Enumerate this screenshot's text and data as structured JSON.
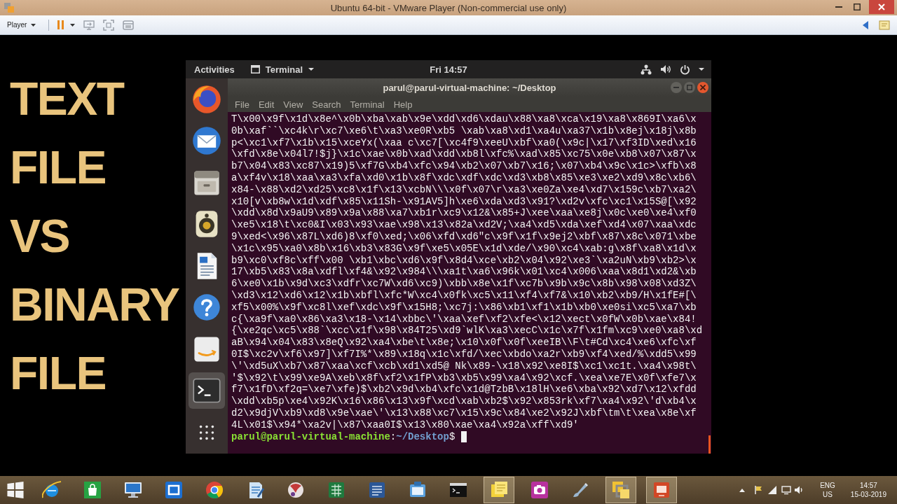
{
  "host_window": {
    "title": "Ubuntu 64-bit - VMware Player (Non-commercial use only)",
    "toolbar": {
      "player_menu": "Player"
    }
  },
  "overlay_title": "TEXT FILE VS BINARY FILE",
  "guest": {
    "top_bar": {
      "activities": "Activities",
      "app_menu": "Terminal",
      "clock": "Fri 14:57"
    },
    "dock": [
      {
        "kind": "browser",
        "selected": false
      },
      {
        "kind": "mail",
        "selected": false
      },
      {
        "kind": "files",
        "selected": false
      },
      {
        "kind": "music",
        "selected": false
      },
      {
        "kind": "writer",
        "selected": false
      },
      {
        "kind": "help",
        "selected": false
      },
      {
        "kind": "store",
        "selected": false
      },
      {
        "kind": "terminal",
        "selected": true
      },
      {
        "kind": "apps",
        "selected": false
      }
    ],
    "terminal": {
      "title": "parul@parul-virtual-machine: ~/Desktop",
      "menu": [
        "File",
        "Edit",
        "View",
        "Search",
        "Terminal",
        "Help"
      ],
      "output_lines": [
        "T\\x00\\x9f\\x1d\\x8e^\\x0b\\xba\\xab\\x9e\\xdd\\xd6\\xdau\\x88\\xa8\\xca\\x19\\xa8\\x869I\\xa6\\x",
        "0b\\xaf``\\xc4k\\r\\xc7\\xe6\\t\\xa3\\xe0R\\xb5 \\xab\\xa8\\xd1\\xa4u\\xa37\\x1b\\x8ej\\x18j\\x8b",
        "p<\\xc1\\xf7\\x1b\\x15\\xceYx(\\xaa c\\xc7[\\xc4f9\\xeeU\\xbf\\xa0(\\x9c|\\x17\\xf3ID\\xed\\x16",
        "\\xfd\\x8e\\x04l7!$j}\\x1c\\xae\\x0b\\xad\\xdd\\xb8l\\xfc%\\xad\\x85\\xc75\\x0e\\xb8\\x07\\x87\\x",
        "b7\\x04\\x83\\xc87\\x19)5\\xf7G\\xb4\\xfc\\x94\\xb2\\x07\\xb7\\x16;\\x07\\xb4\\x9c\\x1c>\\xfb\\x8",
        "a\\xf4v\\x18\\xaa\\xa3\\xfa\\xd0\\x1b\\x8f\\xdc\\xdf\\xdc\\xd3\\xb8\\x85\\xe3\\xe2\\xd9\\x8c\\xb6\\",
        "x84-\\x88\\xd2\\xd25\\xc8\\x1f\\x13\\xcbN\\\\\\x0f\\x07\\r\\xa3\\xe0Za\\xe4\\xd7\\x159c\\xb7\\xa2\\",
        "x10[v\\xb8w\\x1d\\xdf\\x85\\x11Sh-\\x91AV5]h\\xe6\\xda\\xd3\\x91?\\xd2v\\xfc\\xc1\\x15S@[\\x92",
        "\\xdd\\x8d\\x9aU9\\x89\\x9a\\x88\\xa7\\xb1r\\xc9\\x12&\\x85+J\\xee\\xaa\\xe8j\\x0c\\xe0\\xe4\\xf0",
        "\\xe5\\x18\\t\\xc0&I\\x03\\x93\\xae\\x98\\x13\\x82a\\xd2V;\\xa4\\xd5\\xda\\xef\\xd4\\x07\\xaa\\xdc",
        "9\\xed<\\x96\\x87L\\xd6)8\\xf0\\xed;\\x06\\xfd\\xd6\"c\\x9f\\x1f\\x9ej2\\xbf\\x87\\x8c\\x071\\xbe",
        "\\x1c\\x95\\xa0\\x8b\\x16\\xb3\\x83G\\x9f\\xe5\\x05E\\x1d\\xde/\\x90\\xc4\\xab:g\\x8f\\xa8\\x1d\\x",
        "b9\\xc0\\xf8c\\xff\\x00 \\xb1\\xbc\\xd6\\x9f\\x8d4\\xce\\xb2\\x04\\x92\\xe3`\\xa2uN\\xb9\\xb2>\\x",
        "17\\xb5\\x83\\x8a\\xdfl\\xf4&\\x92\\x984\\\\\\xa1t\\xa6\\x96k\\x01\\xc4\\x006\\xaa\\x8d1\\xd2&\\xb",
        "6\\xe0\\x1b\\x9d\\xc3\\xdfr\\xc7W\\xd6\\xc9)\\xbb\\x8e\\x1f\\xc7b\\x9b\\x9c\\x8b\\x98\\x08\\xd3Z\\",
        "\\xd3\\x12\\xd6\\x12\\x1b\\xbfl\\xfc*W\\xc4\\x0fk\\xc5\\x11\\xf4\\xf7&\\x10\\xb2\\xb9/H\\x1fE#[\\",
        "xf5\\x00%\\x9f\\xc8l\\xef\\xdc\\x9f\\x15H8;\\xc7j:\\x86\\xb1\\xf1\\x1b\\xb0\\xe0si\\xc5\\xa7\\xb",
        "c{\\xa9f\\xa0\\x86\\xa3\\x18-\\x14\\xbbc\\'\\xaa\\xef\\xf2\\xfe<\\x12\\xect\\x0fW\\x0b\\xae\\x84!",
        "{\\xe2qc\\xc5\\x88`\\xcc\\x1f\\x98\\x84T25\\xd9`wlK\\xa3\\xecC\\x1c\\x7f\\x1fm\\xc9\\xe0\\xa8\\xd",
        "aB\\x94\\x04\\x83\\x8eQ\\x92\\xa4\\xbe\\t\\x8e;\\x10\\x0f\\x0f\\xeeIB\\\\F\\t#Cd\\xc4\\xe6\\xfc\\xf",
        "0I$\\xc2v\\xf6\\x97]\\xf7I%*\\x89\\x18q\\x1c\\xfd/\\xec\\xbdo\\xa2r\\xb9\\xf4\\xed/%\\xdd5\\x99",
        "\\'\\xd5uX\\xb7\\x87\\xaa\\xcf\\xcb\\xd1\\xd5@ Nk\\x89-\\x18\\x92\\xe8I$\\xc1\\xc1t.\\xa4\\x98t\\",
        "'$\\x92\\t\\x99\\xe9A\\xeb\\x8f\\xf2\\x1fP\\xb3\\xb5\\x99\\xa4\\x92\\xcf.\\xea\\xe7E\\x0f\\xfe7\\x",
        "f7\\x1fD\\xf2q=\\xe7\\xfe)$\\xb2\\x9d\\xb4\\xfc\\x1d@TzbB\\x18lH\\xe6\\xba\\x92\\xd7\\x12\\xfdd",
        "\\xdd\\xb5p\\xe4\\x92K\\x16\\x86\\x13\\x9f\\xcd\\xab\\xb2$\\x92\\x853rk\\xf7\\xa4\\x92\\'d\\xb4\\x",
        "d2\\x9djV\\xb9\\xd8\\x9e\\xae\\'\\x13\\x88\\xc7\\x15\\x9c\\x84\\xe2\\x92J\\xbf\\tm\\t\\xea\\x8e\\xf",
        "4L\\x01$\\x94*\\xa2v|\\x87\\xaa0I$\\x13\\x80\\xae\\xa4\\x92a\\xff\\xd9'"
      ],
      "prompt": {
        "user_host": "parul@parul-virtual-machine",
        "separator": ":",
        "path": "~/Desktop",
        "symbol": "$"
      },
      "cursor": true
    }
  },
  "taskbar": {
    "apps": [
      {
        "kind": "globe",
        "open": false
      },
      {
        "kind": "bag",
        "open": false
      },
      {
        "kind": "monitor",
        "open": false
      },
      {
        "kind": "tile",
        "open": false
      },
      {
        "kind": "wheel",
        "open": false
      },
      {
        "kind": "notepad",
        "open": false
      },
      {
        "kind": "sphere",
        "open": false
      },
      {
        "kind": "sheet",
        "open": false
      },
      {
        "kind": "doc",
        "open": false
      },
      {
        "kind": "clipboard",
        "open": false
      },
      {
        "kind": "console",
        "open": false
      },
      {
        "kind": "notes",
        "open": true
      },
      {
        "kind": "camera",
        "open": false
      },
      {
        "kind": "brush",
        "open": false
      },
      {
        "kind": "squares",
        "open": true
      },
      {
        "kind": "slides",
        "open": true
      }
    ],
    "tray": {
      "language": "ENG",
      "region": "US",
      "time": "14:57",
      "date": "15-03-2019"
    }
  }
}
